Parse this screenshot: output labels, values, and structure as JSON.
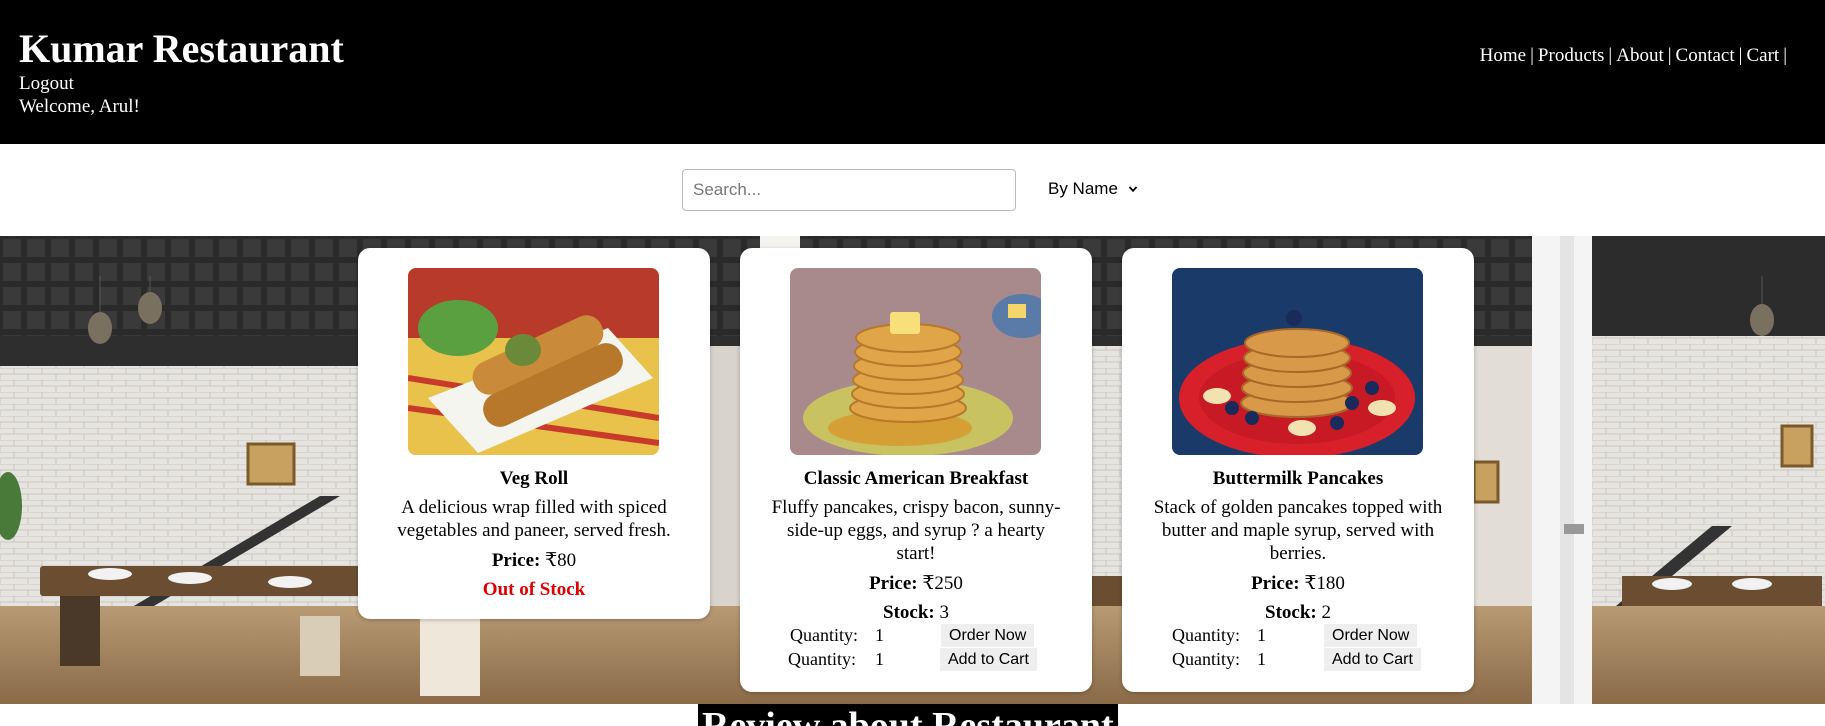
{
  "header": {
    "brand": "Kumar Restaurant",
    "logout": "Logout",
    "welcome": "Welcome, Arul!",
    "nav": [
      "Home",
      "Products",
      "About",
      "Contact",
      "Cart"
    ],
    "separator": "|"
  },
  "search": {
    "placeholder": "Search...",
    "value": ""
  },
  "sort": {
    "selected": "By Name"
  },
  "products": [
    {
      "name": "Veg Roll",
      "description": "A delicious wrap filled with spiced vegetables and paneer, served fresh.",
      "price_label": "Price:",
      "price": "₹80",
      "status": "Out of Stock",
      "image": "veg-roll-photo"
    },
    {
      "name": "Classic American Breakfast",
      "description": "Fluffy pancakes, crispy bacon, sunny-side-up eggs, and syrup ? a hearty start!",
      "price_label": "Price:",
      "price": "₹250",
      "stock_label": "Stock:",
      "stock": "3",
      "quantity_label": "Quantity:",
      "order_quantity": "1",
      "cart_quantity": "1",
      "order_button": "Order Now",
      "cart_button": "Add to Cart",
      "image": "pancake-stack-photo"
    },
    {
      "name": "Buttermilk Pancakes",
      "description": "Stack of golden pancakes topped with butter and maple syrup, served with berries.",
      "price_label": "Price:",
      "price": "₹180",
      "stock_label": "Stock:",
      "stock": "2",
      "quantity_label": "Quantity:",
      "order_quantity": "1",
      "cart_quantity": "1",
      "order_button": "Order Now",
      "cart_button": "Add to Cart",
      "image": "berry-pancakes-photo"
    }
  ],
  "review": {
    "title": "Review about Restaurant"
  },
  "colors": {
    "header_bg": "#000000",
    "out_of_stock": "#e00000"
  }
}
